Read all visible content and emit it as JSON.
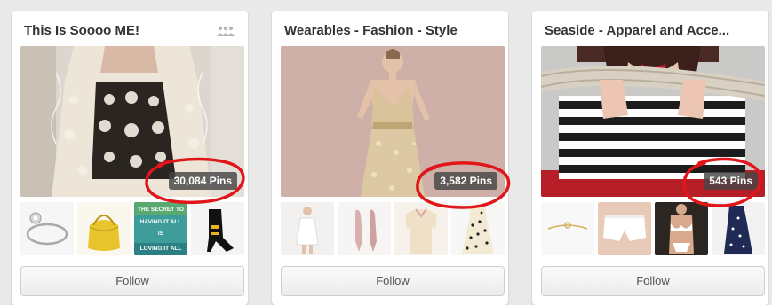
{
  "colors": {
    "page_background": "#e9e9e9",
    "card_background": "#ffffff",
    "annotation_red": "#e0161b",
    "badge_background": "#464646"
  },
  "boards": [
    {
      "title": "This Is Soooo ME!",
      "group_board_icon": "group-board-icon",
      "pin_count": "30,084 Pins",
      "thumbnail_text": [
        "THE SECRET TO",
        "HAVING IT ALL",
        "IS",
        "LOVING IT ALL"
      ],
      "follow_label": "Follow"
    },
    {
      "title": "Wearables - Fashion - Style",
      "pin_count": "3,582 Pins",
      "follow_label": "Follow"
    },
    {
      "title": "Seaside - Apparel and Acce...",
      "pin_count": "543 Pins",
      "follow_label": "Follow"
    }
  ]
}
